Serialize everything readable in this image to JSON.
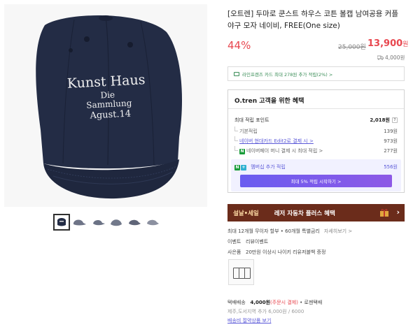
{
  "product": {
    "title": "[오트렌] 두마로 쿤스트 하우스 코튼 볼캡 남여공용 커플 야구 모자 네이비, FREE(One size)",
    "discount_rate": "44%",
    "original_price": "25,000원",
    "sale_price_number": "13,900",
    "sale_price_unit": "원",
    "shipping_fee_mini": "4,000원",
    "cap_embroidery": [
      "Kunst Haus",
      "Die",
      "Sammlung",
      "Agust.14"
    ]
  },
  "card_banner": "라인프렌즈 카드 최대 278원 추가 적립(2%) >",
  "benefit": {
    "heading": "O.tren 고객을 위한 혜택",
    "total_label": "최대 적립 포인트",
    "total_value": "2,018원",
    "help_mark": "?",
    "rows": [
      {
        "label": "기본적립",
        "value": "139원"
      },
      {
        "label": "네이버 현대카드 Edit2로 결제 시 >",
        "value": "973원"
      },
      {
        "label": "네이버페이 머니 결제 시 최대 적립 >",
        "value": "277원"
      }
    ],
    "n_badge": "N",
    "member_label": "멤버십 추가 적립",
    "member_value": "556원",
    "member_badges": [
      "N",
      "+"
    ],
    "member_button": "최대 5% 적립 시작하기 >"
  },
  "ad_banner": {
    "tag": "설날•세일",
    "text": "레저 자동차 플러스 혜택",
    "arrow": "›"
  },
  "info": {
    "installment": "최대 12개월 무이자 할부 • 60개월 특별금리",
    "installment_link": "자세히보기 >",
    "event_label": "이벤트",
    "event_value": "리뷰이벤트",
    "gift_label": "사은품",
    "gift_value": "20만원 이상시 나이키 리유저블백 증정"
  },
  "shipping": {
    "label": "택배배송",
    "fee": "4,000원",
    "note": "(주문시 결제)",
    "carrier": "• 로젠택배",
    "extra": "제주,도서지역 추가 6,000원 / 6000",
    "link": "배송비 절약상품 보기"
  },
  "colors": {
    "accent_red": "#e8474f",
    "link_purple": "#5b59d8",
    "naver_green": "#1a9c3a",
    "ad_brown": "#6b2c1b",
    "cap_navy": "#232c45"
  }
}
